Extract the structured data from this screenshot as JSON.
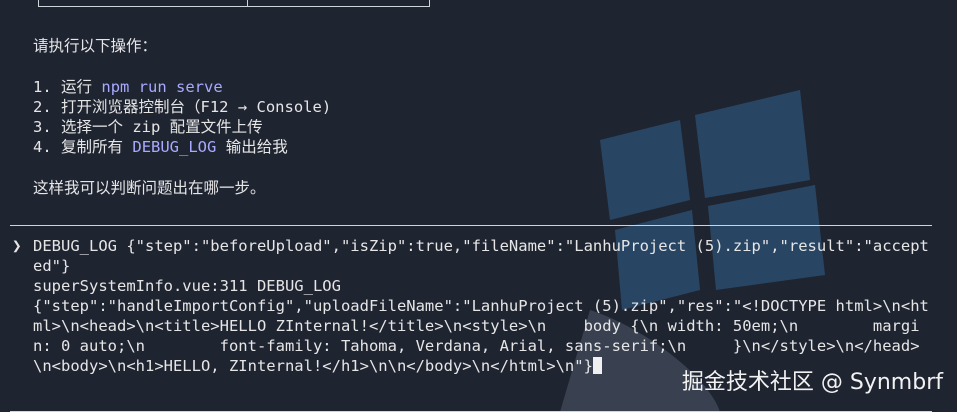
{
  "instructions": {
    "heading": "请执行以下操作：",
    "steps": [
      {
        "num": "1.",
        "prefix": "运行 ",
        "code": "npm run serve",
        "suffix": ""
      },
      {
        "num": "2.",
        "prefix": "打开浏览器控制台（F12 → Console)",
        "code": "",
        "suffix": ""
      },
      {
        "num": "3.",
        "prefix": "选择一个 zip 配置文件上传",
        "code": "",
        "suffix": ""
      },
      {
        "num": "4.",
        "prefix": "复制所有 ",
        "code": "DEBUG_LOG",
        "suffix": " 输出给我"
      }
    ],
    "footer": "这样我可以判断问题出在哪一步。"
  },
  "console": {
    "prompt_icon": "chevron-right-icon",
    "log": "DEBUG_LOG {\"step\":\"beforeUpload\",\"isZip\":true,\"fileName\":\"LanhuProject (5).zip\",\"result\":\"accepted\"}\nsuperSystemInfo.vue:311 DEBUG_LOG\n{\"step\":\"handleImportConfig\",\"uploadFileName\":\"LanhuProject (5).zip\",\"res\":\"<!DOCTYPE html>\\n<html>\\n<head>\\n<title>HELLO ZInternal!</title>\\n<style>\\n    body {\\n width: 50em;\\n        margin: 0 auto;\\n        font-family: Tahoma, Verdana, Arial, sans-serif;\\n     }\\n</style>\\n</head>\\n<body>\\n<h1>HELLO, ZInternal!</h1>\\n\\n</body>\\n</html>\\n\"}"
  },
  "watermark": "掘金技术社区 @ Synmbrf",
  "colors": {
    "background": "#1f2431",
    "highlight": "#a9a9ff"
  }
}
